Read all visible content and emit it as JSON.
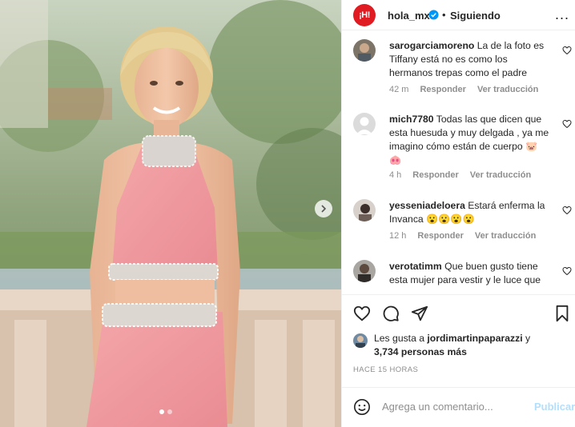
{
  "post": {
    "image_alt": "Mujer rubia sonriente con top y falda rosa con pedrería",
    "carousel": {
      "current": 1,
      "total": 2
    }
  },
  "header": {
    "logo_text": "¡H!",
    "username": "hola_mx",
    "separator": "•",
    "follow_status": "Siguiendo",
    "more_label": "..."
  },
  "comments": [
    {
      "username": "sarogarciamoreno",
      "text": "La de la foto es Tiffany está no es como los hermanos trepas como el padre",
      "time": "42 m",
      "reply": "Responder",
      "translate": "Ver traducción"
    },
    {
      "username": "mich7780",
      "text": "Todas las que dicen que esta huesuda y muy delgada , ya me imagino cómo están de cuerpo 🐷🐽",
      "time": "4 h",
      "reply": "Responder",
      "translate": "Ver traducción"
    },
    {
      "username": "yesseniadeloera",
      "text": "Estará enferma la Invanca 😮😮😮😮",
      "time": "12 h",
      "reply": "Responder",
      "translate": "Ver traducción"
    },
    {
      "username": "verotatimm",
      "text": "Que buen gusto tiene esta mujer para vestir y le luce que",
      "time": "",
      "reply": "",
      "translate": ""
    }
  ],
  "likes": {
    "prefix": "Les gusta a ",
    "first_user": "jordimartinpaparazzi",
    "conj": " y",
    "others": "3,734 personas más"
  },
  "time_ago": "HACE 15 HORAS",
  "add_comment": {
    "placeholder": "Agrega un comentario...",
    "publish": "Publicar"
  },
  "colors": {
    "brand_red": "#e11b22",
    "verified_blue": "#0095f6",
    "muted": "#8e8e8e",
    "publish_disabled": "#b2dffc"
  }
}
